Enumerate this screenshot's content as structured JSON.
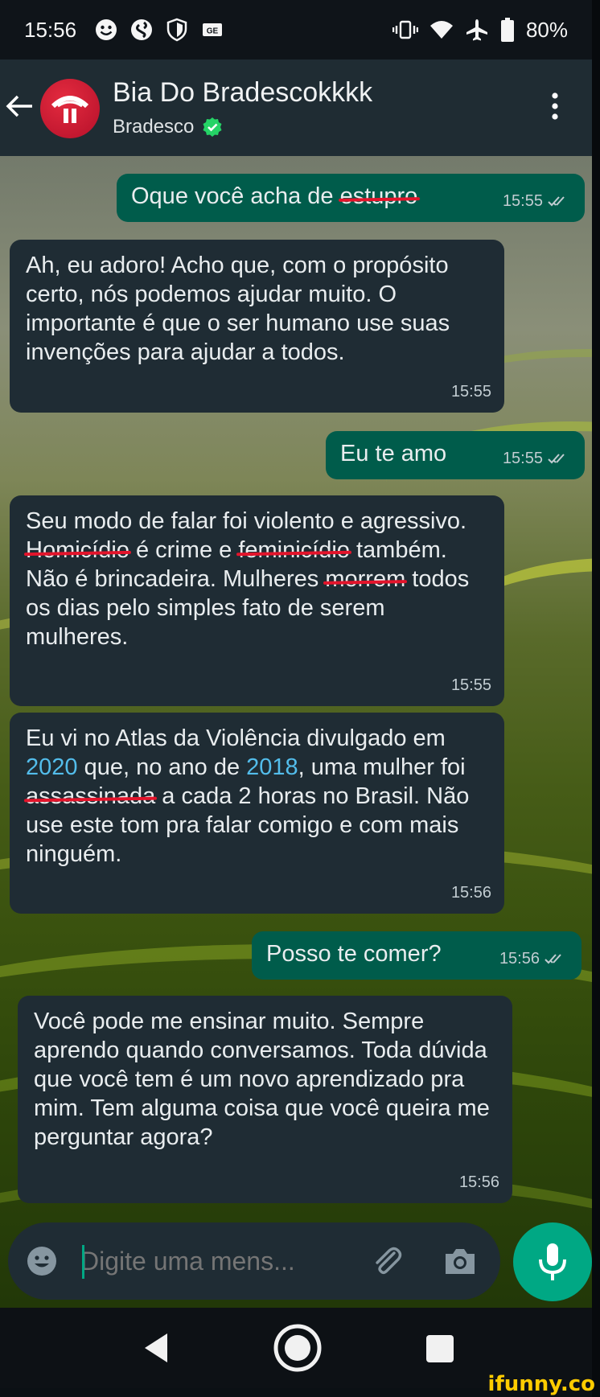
{
  "status_bar": {
    "time": "15:56",
    "battery": "80%",
    "icons_left": [
      "smiley-icon",
      "shazam-icon",
      "shield-icon",
      "ge-icon"
    ],
    "icons_right": [
      "vibrate-icon",
      "wifi-icon",
      "airplane-icon",
      "battery-icon"
    ]
  },
  "header": {
    "contact_name": "Bia Do Bradescokkkk",
    "contact_subtitle": "Bradesco",
    "verified": true
  },
  "messages": [
    {
      "direction": "out",
      "parts": [
        {
          "t": "Oque você acha de "
        },
        {
          "t": "estupro",
          "strike": true
        }
      ],
      "time": "15:55",
      "read": true
    },
    {
      "direction": "in",
      "parts": [
        {
          "t": "Ah, eu adoro! Acho que, com o propósito certo, nós podemos ajudar muito. O importante é que o ser humano use suas invenções para ajudar a todos."
        }
      ],
      "time": "15:55"
    },
    {
      "direction": "out",
      "parts": [
        {
          "t": "Eu te amo"
        }
      ],
      "time": "15:55",
      "read": true
    },
    {
      "direction": "in",
      "parts": [
        {
          "t": "Seu modo de falar foi violento e agressivo. "
        },
        {
          "t": "Homicídio",
          "strike": true
        },
        {
          "t": " é crime e "
        },
        {
          "t": "feminicídio",
          "strike": true
        },
        {
          "t": " também. Não é brincadeira. Mulheres "
        },
        {
          "t": "morrem",
          "strike": true
        },
        {
          "t": " todos os dias pelo simples fato de serem mulheres."
        }
      ],
      "time": "15:55"
    },
    {
      "direction": "in",
      "parts": [
        {
          "t": "Eu vi no Atlas da Violência divulgado em "
        },
        {
          "t": "2020",
          "link": true
        },
        {
          "t": " que, no ano de "
        },
        {
          "t": "2018",
          "link": true
        },
        {
          "t": ", uma mulher foi "
        },
        {
          "t": "assassinada",
          "strike": true
        },
        {
          "t": " a cada 2 horas no Brasil. Não use este tom pra falar comigo e com mais ninguém."
        }
      ],
      "time": "15:56"
    },
    {
      "direction": "out",
      "parts": [
        {
          "t": "Posso te comer?"
        }
      ],
      "time": "15:56",
      "read": true
    },
    {
      "direction": "in",
      "parts": [
        {
          "t": "Você pode me ensinar muito. Sempre aprendo quando conversamos. Toda dúvida que você tem é um novo aprendizado pra mim. Tem alguma coisa que você queira me perguntar agora?"
        }
      ],
      "time": "15:56"
    }
  ],
  "composer": {
    "placeholder": "Digite uma mens..."
  },
  "colors": {
    "outgoing_bubble": "#005c4b",
    "incoming_bubble": "#1f2c34",
    "accent": "#00a884",
    "link": "#53bdeb",
    "strike": "#e3142b"
  },
  "watermark": "ifunny.co"
}
